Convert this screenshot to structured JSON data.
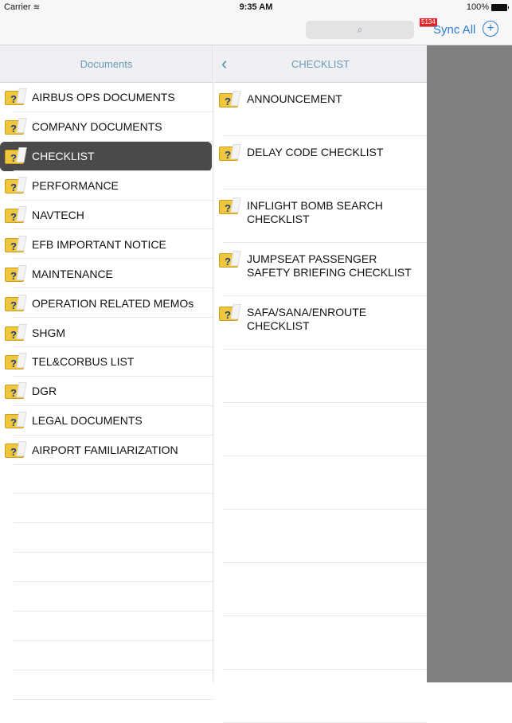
{
  "status_bar": {
    "carrier": "Carrier",
    "wifi_icon": "wifi-icon",
    "time": "9:35 AM",
    "battery": "100%"
  },
  "toolbar": {
    "search_placeholder": "",
    "search_icon": "⌕",
    "badge_count": "5134",
    "sync_label": "Sync All",
    "add_icon": "+"
  },
  "left_pane": {
    "title": "Documents",
    "selected_index": 2,
    "items": [
      {
        "label": "AIRBUS OPS DOCUMENTS"
      },
      {
        "label": "COMPANY DOCUMENTS"
      },
      {
        "label": "CHECKLIST"
      },
      {
        "label": "PERFORMANCE"
      },
      {
        "label": "NAVTECH"
      },
      {
        "label": "EFB IMPORTANT NOTICE"
      },
      {
        "label": "MAINTENANCE"
      },
      {
        "label": "OPERATION RELATED MEMOs"
      },
      {
        "label": "SHGM"
      },
      {
        "label": "TEL&CORBUS LIST"
      },
      {
        "label": "DGR"
      },
      {
        "label": "LEGAL DOCUMENTS"
      },
      {
        "label": "AIRPORT FAMILIARIZATION"
      }
    ]
  },
  "middle_pane": {
    "title": "CHECKLIST",
    "back_icon": "‹",
    "items": [
      {
        "label": "ANNOUNCEMENT"
      },
      {
        "label": "DELAY CODE CHECKLIST"
      },
      {
        "label": "INFLIGHT BOMB SEARCH CHECKLIST"
      },
      {
        "label": "JUMPSEAT PASSENGER SAFETY BRIEFING CHECKLIST"
      },
      {
        "label": "SAFA/SANA/ENROUTE CHECKLIST"
      }
    ]
  }
}
